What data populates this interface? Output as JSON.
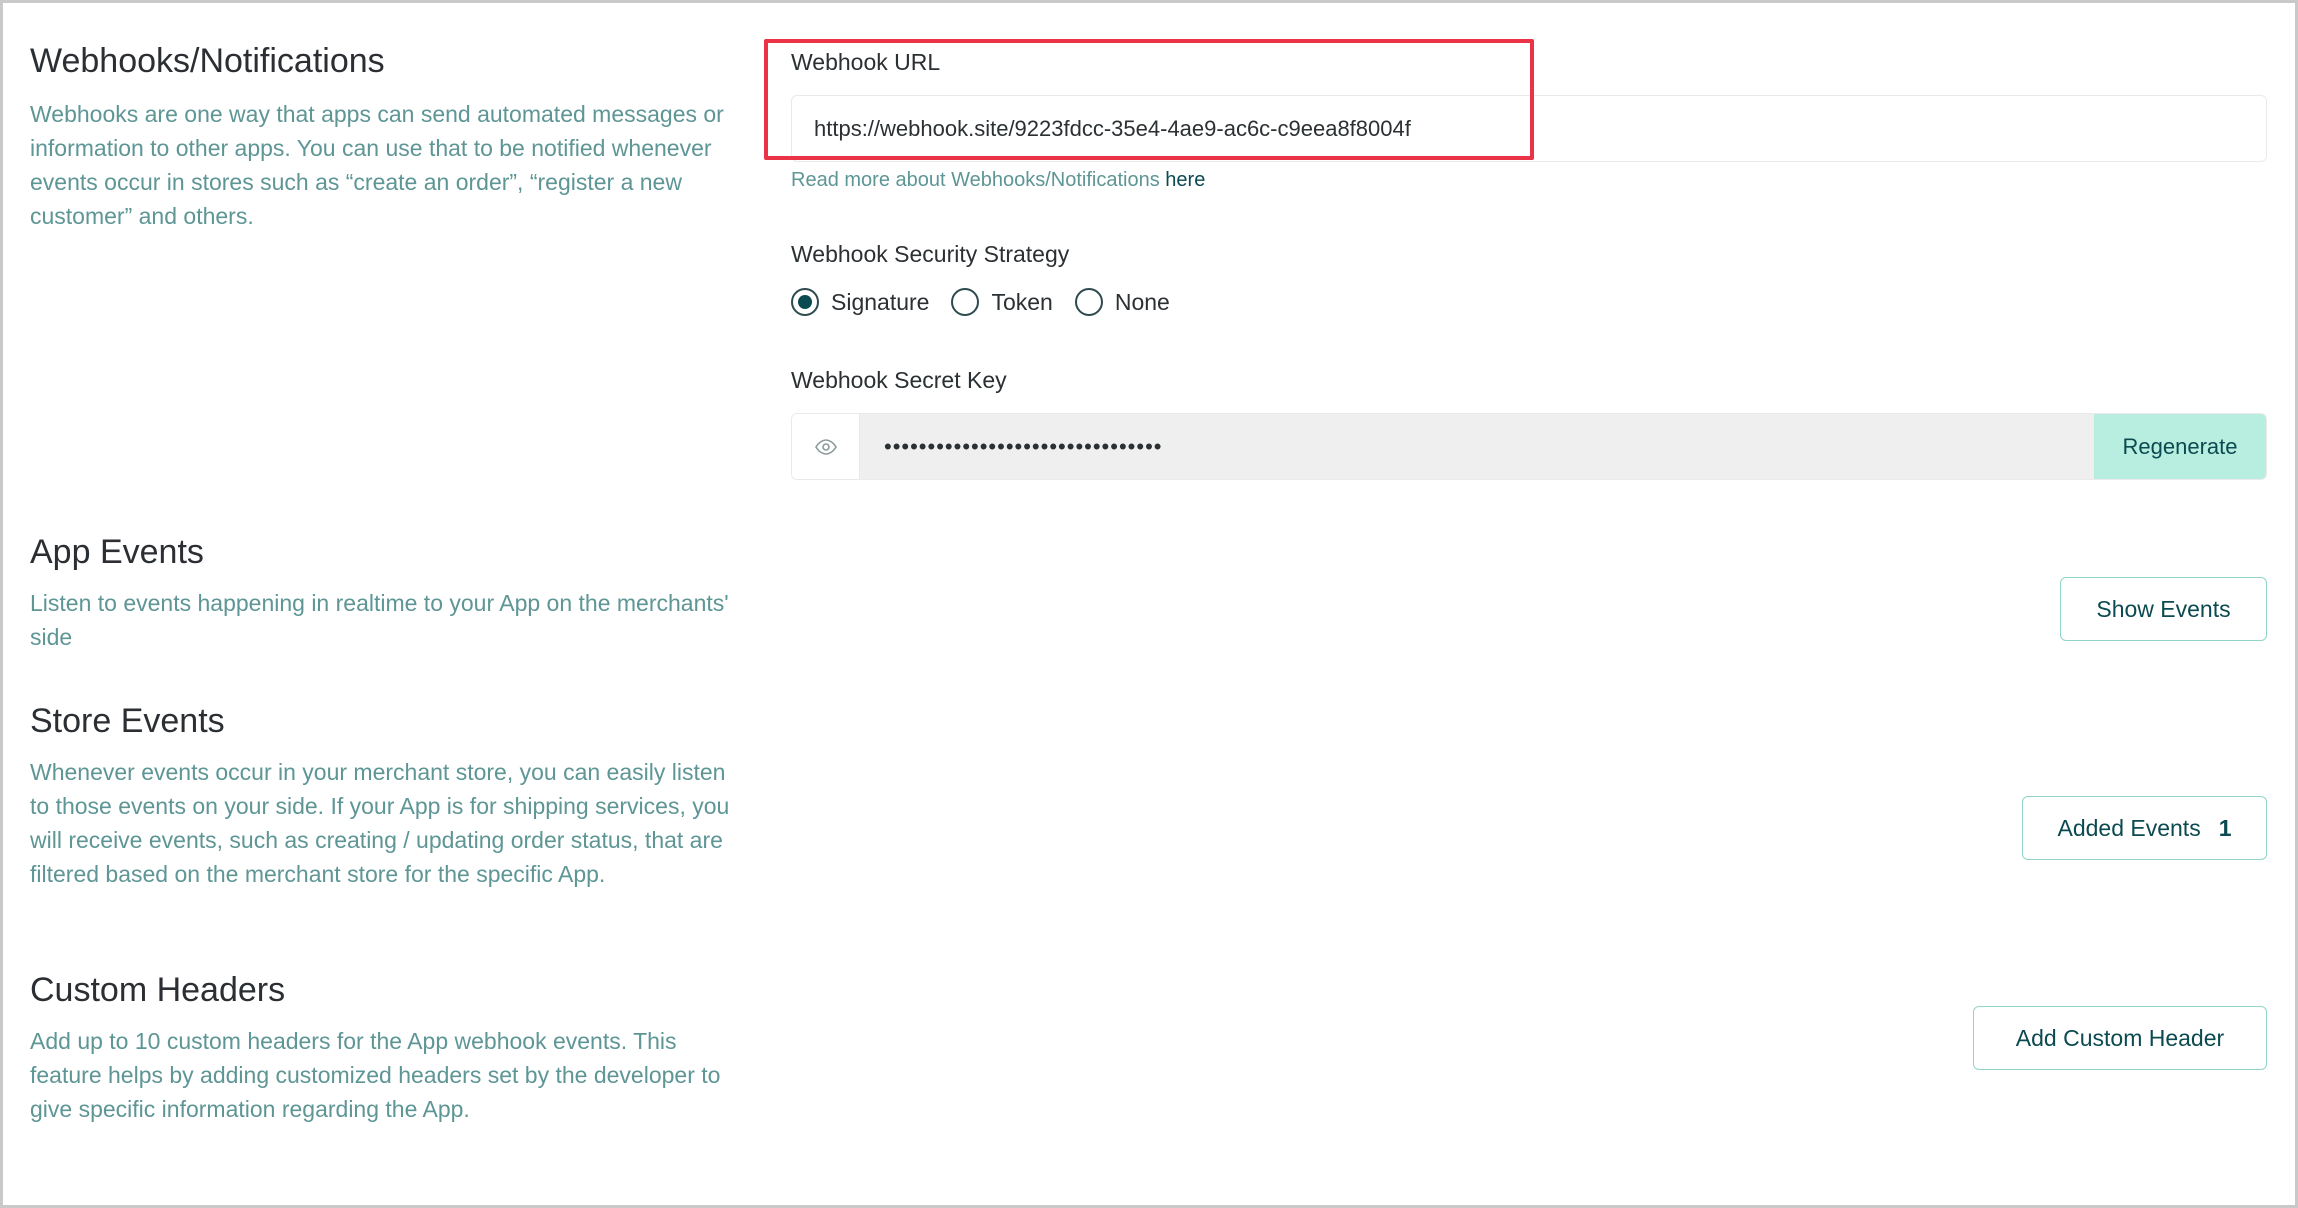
{
  "webhooks": {
    "title": "Webhooks/Notifications",
    "description": "Webhooks are one way that apps can send automated messages or information to other apps. You can use that to be notified whenever events occur in stores such as “create an order”, “register a new customer” and others.",
    "url_label": "Webhook URL",
    "url_value": "https://webhook.site/9223fdcc-35e4-4ae9-ac6c-c9eea8f8004f",
    "help_text": "Read more about Webhooks/Notifications",
    "help_link": "here",
    "security_label": "Webhook Security Strategy",
    "security_options": [
      "Signature",
      "Token",
      "None"
    ],
    "security_selected": "Signature",
    "secret_label": "Webhook Secret Key",
    "secret_value": "••••••••••••••••••••••••••••••••",
    "regenerate_label": "Regenerate"
  },
  "app_events": {
    "title": "App Events",
    "description": "Listen to events happening in realtime to your App on the merchants' side",
    "button_label": "Show Events"
  },
  "store_events": {
    "title": "Store Events",
    "description": "Whenever events occur in your merchant store, you can easily listen to those events on your side. If your App is for shipping services, you will receive events, such as creating / updating order status, that are filtered based on the merchant store for the specific App.",
    "button_label": "Added Events",
    "count": "1"
  },
  "custom_headers": {
    "title": "Custom Headers",
    "description": "Add up to 10 custom headers for the App webhook events. This feature helps by adding customized headers set by the developer to give specific information regarding the App.",
    "button_label": "Add Custom Header"
  },
  "colors": {
    "accent": "#0b4a50",
    "muted_text": "#5e9595",
    "button_fill": "#b8eedf",
    "highlight": "#ea3346"
  }
}
